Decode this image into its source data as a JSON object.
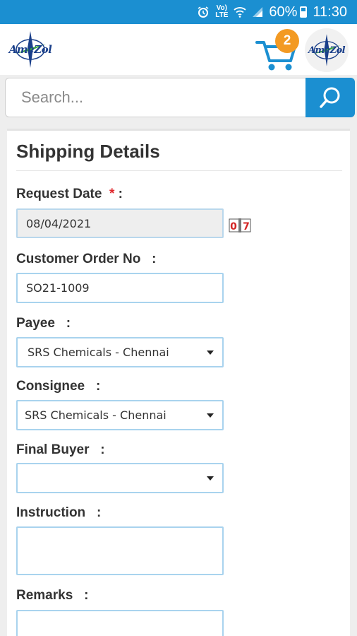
{
  "status_bar": {
    "network_top": "Vo)",
    "network_bottom": "LTE",
    "battery": "60%",
    "time": "11:30"
  },
  "header": {
    "logo_text": "AmeZol",
    "cart_count": "2"
  },
  "search": {
    "placeholder": "Search..."
  },
  "form": {
    "title": "Shipping Details",
    "request_date_label": "Request Date",
    "required_mark": "*",
    "colon_tight": " :",
    "request_date_value": "08/04/2021",
    "customer_order_label": "Customer Order No   :",
    "customer_order_value": "SO21-1009",
    "payee_label": "Payee   :",
    "payee_value": "SRS Chemicals - Chennai",
    "consignee_label": "Consignee   :",
    "consignee_value": "SRS Chemicals - Chennai",
    "final_buyer_label": "Final Buyer   :",
    "final_buyer_value": "",
    "instruction_label": "Instruction   :",
    "remarks_label": "Remarks   :"
  },
  "colors": {
    "primary": "#1b8fd1",
    "badge": "#f39a23",
    "required": "#e0282d",
    "field_border": "#a9d3ee"
  }
}
